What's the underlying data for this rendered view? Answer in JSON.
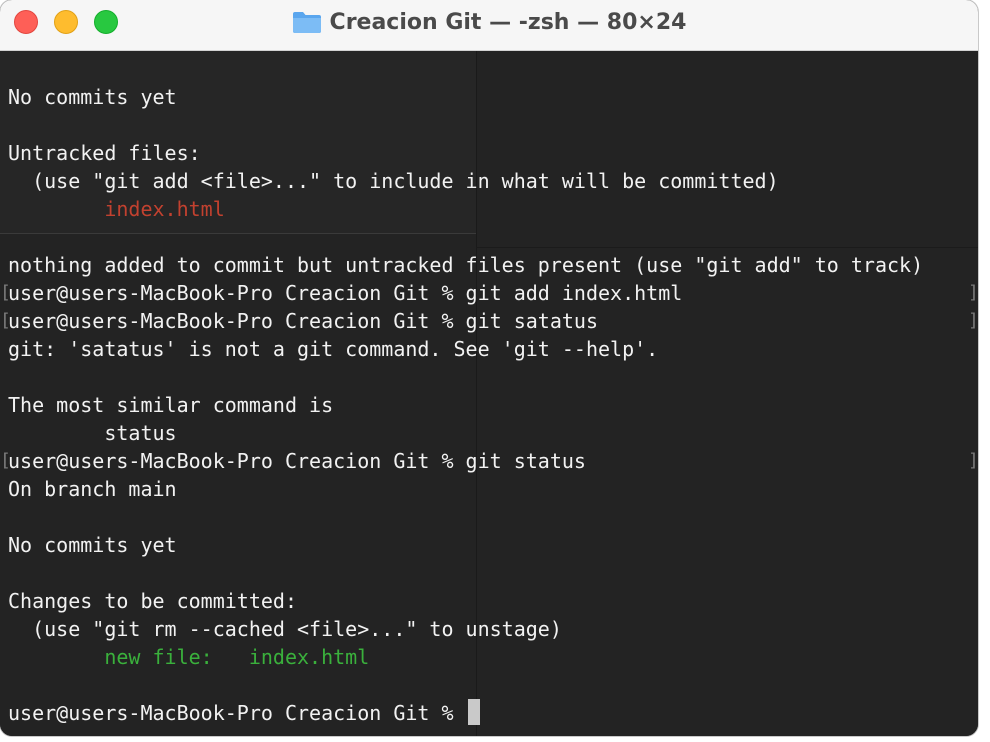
{
  "window": {
    "title": "Creacion Git — -zsh — 80×24",
    "folder_icon": "folder-icon",
    "traffic_lights": {
      "close_color": "#fe5f57",
      "minimize_color": "#febc2e",
      "zoom_color": "#28c840"
    }
  },
  "terminal": {
    "colors": {
      "background": "#232323",
      "text": "#f2f2f2",
      "untracked": "#c2412f",
      "staged": "#3ab03c"
    },
    "lines": [
      {
        "text": "No commits yet"
      },
      {
        "text": ""
      },
      {
        "text": "Untracked files:"
      },
      {
        "text": "  (use \"git add <file>...\" to include in what will be committed)"
      },
      {
        "indent": "        ",
        "text": "index.html",
        "color": "red"
      },
      {
        "text": ""
      },
      {
        "text": "nothing added to commit but untracked files present (use \"git add\" to track)"
      },
      {
        "text": "user@users-MacBook-Pro Creacion Git % git add index.html",
        "prompt": true
      },
      {
        "text": "user@users-MacBook-Pro Creacion Git % git satatus",
        "prompt": true
      },
      {
        "text": "git: 'satatus' is not a git command. See 'git --help'."
      },
      {
        "text": ""
      },
      {
        "text": "The most similar command is"
      },
      {
        "text": "        status"
      },
      {
        "text": "user@users-MacBook-Pro Creacion Git % git status",
        "prompt": true
      },
      {
        "text": "On branch main"
      },
      {
        "text": ""
      },
      {
        "text": "No commits yet"
      },
      {
        "text": ""
      },
      {
        "text": "Changes to be committed:"
      },
      {
        "text": "  (use \"git rm --cached <file>...\" to unstage)"
      },
      {
        "indent": "        ",
        "text": "new file:   index.html",
        "color": "green"
      },
      {
        "text": ""
      }
    ],
    "current_prompt": "user@users-MacBook-Pro Creacion Git % "
  }
}
